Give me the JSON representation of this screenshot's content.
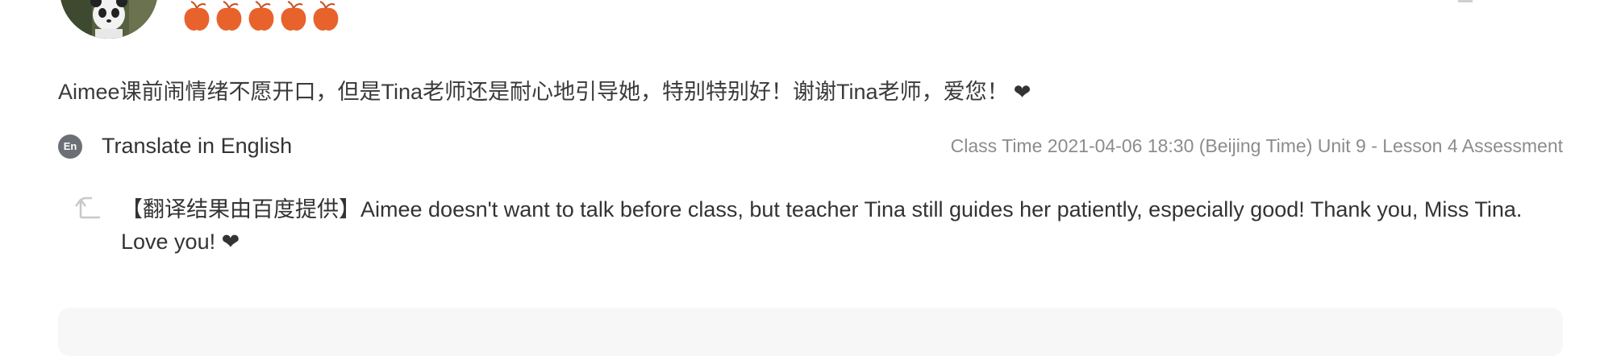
{
  "review": {
    "rating_count": 5,
    "rating_color": "#e8622c",
    "text": "Aimee课前闹情绪不愿开口，但是Tina老师还是耐心地引导她，特别特别好！谢谢Tina老师，爱您！",
    "heart_icon": "heart-icon"
  },
  "translate": {
    "icon_label": "En",
    "label": "Translate in English"
  },
  "class_info": "Class Time 2021-04-06 18:30 (Beijing Time) Unit 9 - Lesson 4 Assessment",
  "translation": {
    "text": "【翻译结果由百度提供】Aimee doesn't want to talk before class, but teacher Tina still guides her patiently, especially good! Thank you, Miss Tina. Love you!",
    "reply_icon": "reply-arrow-icon"
  }
}
